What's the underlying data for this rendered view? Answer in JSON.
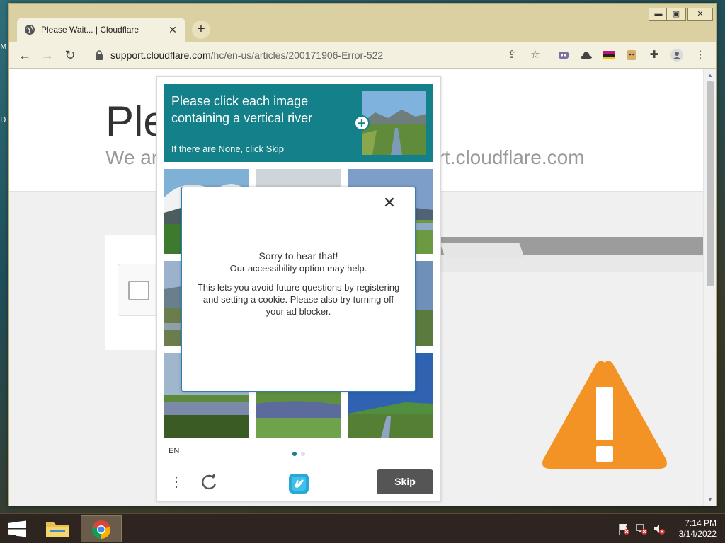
{
  "desktop": {
    "edge_letters": [
      "M",
      "D"
    ]
  },
  "browser": {
    "tab": {
      "title": "Please Wait... | Cloudflare"
    },
    "window_controls": {
      "minimize": "▬",
      "maximize": "▣",
      "close": "✕"
    },
    "url": {
      "host": "support.cloudflare.com",
      "path": "/hc/en-us/articles/200171906-Error-522"
    }
  },
  "page": {
    "title_fragment": "Ple",
    "subtitle_fragment_left": "We ar",
    "subtitle_fragment_right": "ort.cloudflare.com"
  },
  "captcha": {
    "prompt": "Please click each image containing a vertical river",
    "hint": "If there are None, click Skip",
    "language": "EN",
    "skip_label": "Skip",
    "menu_glyph": "⋮"
  },
  "dialog": {
    "close_glyph": "✕",
    "line1": "Sorry to hear that!",
    "line2": "Our accessibility option may help.",
    "line3": "This lets you avoid future questions by registering and setting a cookie. Please also try turning off your ad blocker."
  },
  "taskbar": {
    "time": "7:14 PM",
    "date": "3/14/2022"
  },
  "colors": {
    "captcha_accent": "#13808a",
    "warning_orange": "#f39325",
    "skip_button": "#555555",
    "title_bar": "#dbd0a2"
  }
}
